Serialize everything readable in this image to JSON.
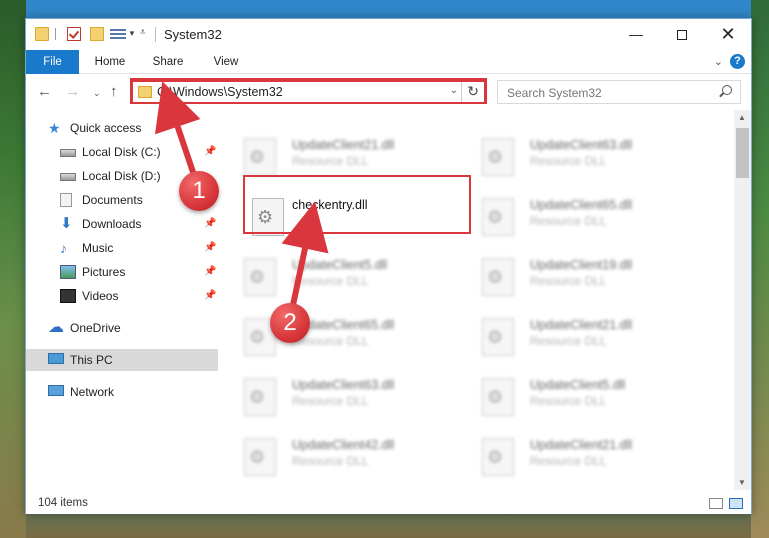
{
  "window": {
    "title": "System32"
  },
  "ribbon": {
    "tabs": [
      "File",
      "Home",
      "Share",
      "View"
    ]
  },
  "nav": {
    "address": "C:\\Windows\\System32",
    "search_placeholder": "Search System32"
  },
  "sidebar": {
    "items": [
      {
        "label": "Quick access",
        "icon": "star-icon"
      },
      {
        "label": "Local Disk (C:)",
        "icon": "disk-icon",
        "pinned": true
      },
      {
        "label": "Local Disk (D:)",
        "icon": "disk-icon",
        "pinned": false
      },
      {
        "label": "Documents",
        "icon": "documents-icon",
        "pinned": true
      },
      {
        "label": "Downloads",
        "icon": "download-icon",
        "pinned": true
      },
      {
        "label": "Music",
        "icon": "music-icon",
        "pinned": true
      },
      {
        "label": "Pictures",
        "icon": "pictures-icon",
        "pinned": true
      },
      {
        "label": "Videos",
        "icon": "videos-icon",
        "pinned": true
      },
      {
        "label": "OneDrive",
        "icon": "cloud-icon"
      },
      {
        "label": "This PC",
        "icon": "pc-icon",
        "selected": true
      },
      {
        "label": "Network",
        "icon": "network-icon"
      }
    ]
  },
  "files": {
    "left_column": [
      {
        "name": "UpdateClient21.dll",
        "type": "Resource DLL",
        "blurred": true
      },
      {
        "name": "checkentry.dll",
        "type": "",
        "blurred": false,
        "highlighted": true
      },
      {
        "name": "UpdateClient5.dll",
        "type": "Resource DLL",
        "blurred": true
      },
      {
        "name": "UpdateClient65.dll",
        "type": "Resource DLL",
        "blurred": true
      },
      {
        "name": "UpdateClient63.dll",
        "type": "Resource DLL",
        "blurred": true
      },
      {
        "name": "UpdateClient42.dll",
        "type": "Resource DLL",
        "blurred": true
      }
    ],
    "right_column": [
      {
        "name": "UpdateClient63.dll",
        "type": "Resource DLL",
        "blurred": true
      },
      {
        "name": "UpdateClient65.dll",
        "type": "Resource DLL",
        "blurred": true
      },
      {
        "name": "UpdateClient19.dll",
        "type": "Resource DLL",
        "blurred": true
      },
      {
        "name": "UpdateClient21.dll",
        "type": "Resource DLL",
        "blurred": true
      },
      {
        "name": "UpdateClient5.dll",
        "type": "Resource DLL",
        "blurred": true
      },
      {
        "name": "UpdateClient21.dll",
        "type": "Resource DLL",
        "blurred": true
      }
    ]
  },
  "status": {
    "item_count": "104 items"
  },
  "annotations": {
    "step1": "1",
    "step2": "2",
    "highlight_color": "#d9363e"
  },
  "colors": {
    "accent": "#1979ca",
    "selection": "#d9d9d9"
  }
}
